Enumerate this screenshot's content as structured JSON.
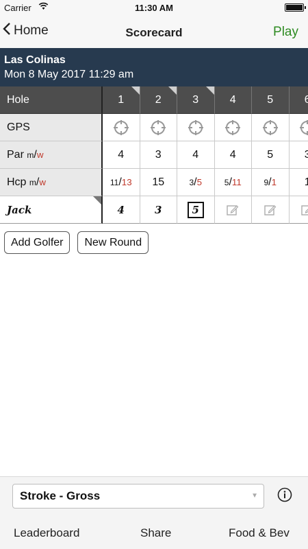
{
  "status_bar": {
    "carrier": "Carrier",
    "time": "11:30 AM"
  },
  "nav": {
    "back_label": "Home",
    "title": "Scorecard",
    "play_label": "Play",
    "play_color": "#2e8b22"
  },
  "course": {
    "name": "Las Colinas",
    "datetime": "Mon 8 May 2017 11:29 am",
    "header_color": "#273a4f"
  },
  "scorecard": {
    "row_labels": {
      "hole": "Hole",
      "gps": "GPS",
      "par": "Par",
      "hcp": "Hcp",
      "men": "m",
      "women": "w",
      "slash": "/"
    },
    "holes": [
      "1",
      "2",
      "3",
      "4",
      "5",
      "6"
    ],
    "par": [
      "4",
      "3",
      "4",
      "4",
      "5",
      "3"
    ],
    "hcp": [
      {
        "men": "11",
        "women": "13"
      },
      {
        "single": "15"
      },
      {
        "men": "3",
        "women": "5"
      },
      {
        "men": "5",
        "women": "11"
      },
      {
        "men": "9",
        "women": "1"
      },
      {
        "single": "1"
      }
    ],
    "player": {
      "name": "Jack",
      "scores": [
        "4",
        "3",
        "5",
        "",
        "",
        ""
      ]
    }
  },
  "buttons": {
    "add_golfer": "Add Golfer",
    "new_round": "New Round"
  },
  "bottom": {
    "scoring_mode": "Stroke - Gross",
    "tabs": {
      "leaderboard": "Leaderboard",
      "share": "Share",
      "food": "Food & Bev"
    }
  }
}
